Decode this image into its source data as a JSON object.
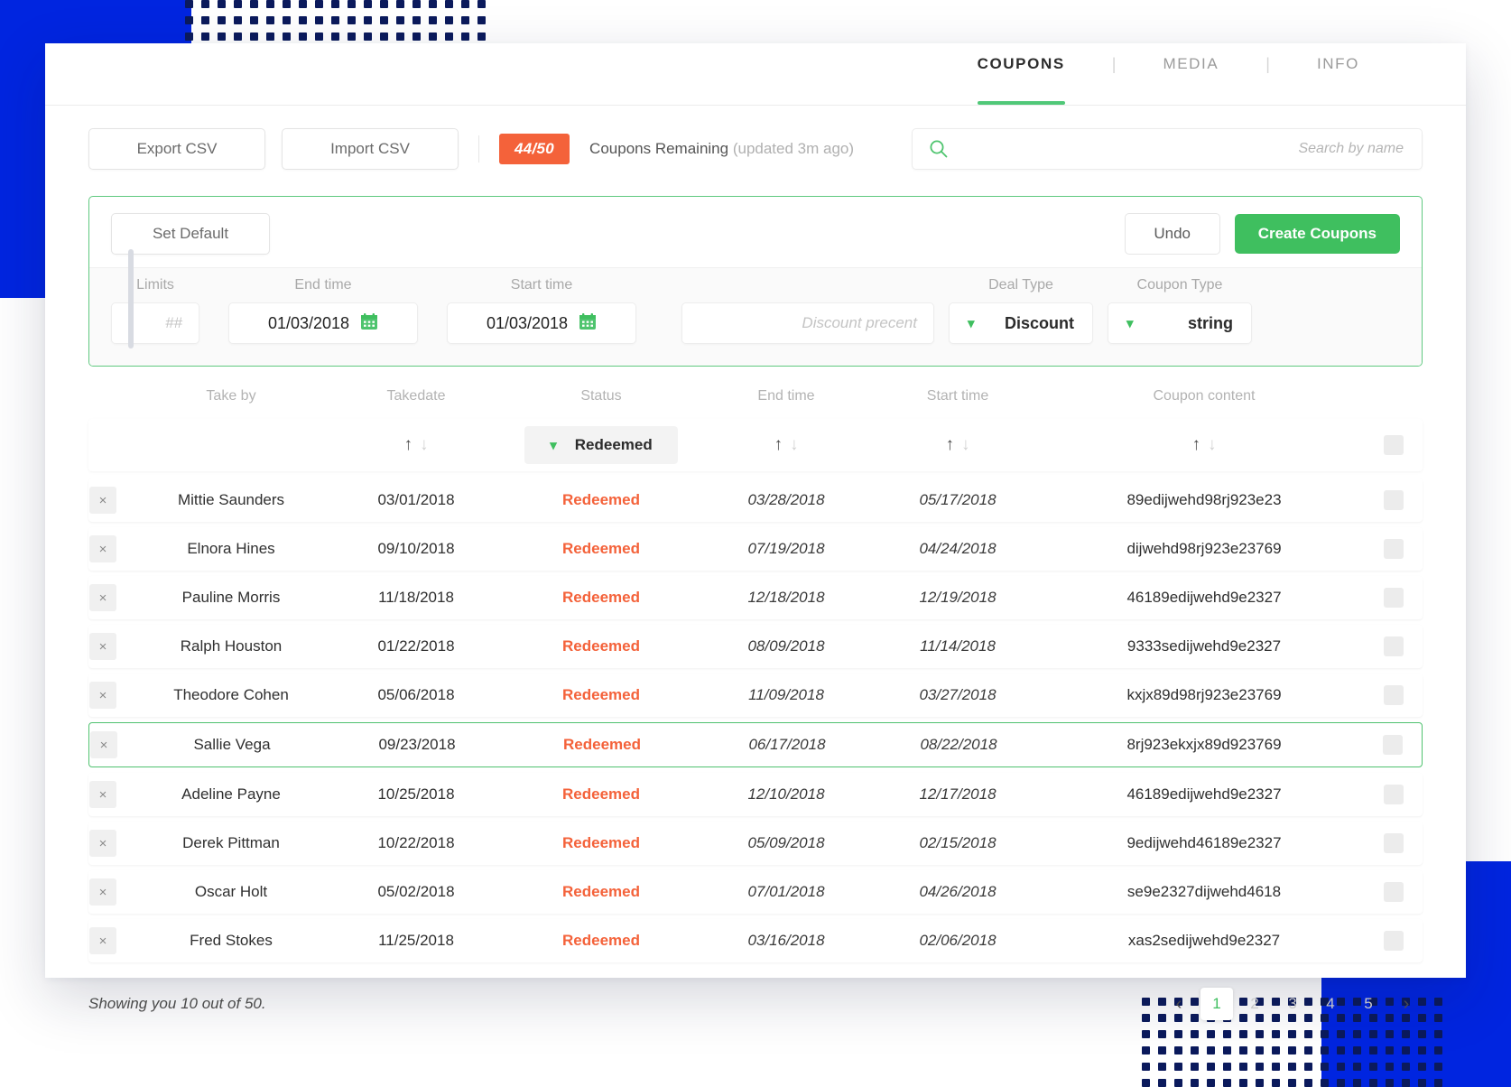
{
  "tabs": [
    {
      "label": "COUPONS",
      "active": true
    },
    {
      "label": "MEDIA",
      "active": false
    },
    {
      "label": "INFO",
      "active": false
    }
  ],
  "tab_separator": "|",
  "toolbar": {
    "export_label": "Export CSV",
    "import_label": "Import CSV",
    "badge": "44/50",
    "remaining_label": "Coupons Remaining",
    "remaining_note": "(updated 3m ago)"
  },
  "search": {
    "placeholder": "Search by name",
    "value": "",
    "icon": "search-icon"
  },
  "panel": {
    "set_default_label": "Set Default",
    "undo_label": "Undo",
    "create_label": "Create Coupons",
    "fields": {
      "limits_label": "Limits",
      "limits_placeholder": "##",
      "limits_value": "",
      "end_time_label": "End time",
      "end_time_value": "01/03/2018",
      "start_time_label": "Start time",
      "start_time_value": "01/03/2018",
      "discount_placeholder": "Discount precent",
      "discount_value": "",
      "deal_type_label": "Deal Type",
      "deal_type_value": "Discount",
      "coupon_type_label": "Coupon Type",
      "coupon_type_value": "string"
    }
  },
  "table": {
    "headers": {
      "take_by": "Take by",
      "takedate": "Takedate",
      "status": "Status",
      "end_time": "End time",
      "start_time": "Start time",
      "coupon_content": "Coupon content"
    },
    "filter": {
      "status_value": "Redeemed",
      "sort_up": "↑",
      "sort_down": "↓"
    },
    "rows": [
      {
        "name": "Mittie Saunders",
        "takedate": "03/01/2018",
        "status": "Redeemed",
        "end": "03/28/2018",
        "start": "05/17/2018",
        "content": "89edijwehd98rj923e23",
        "selected": false
      },
      {
        "name": "Elnora Hines",
        "takedate": "09/10/2018",
        "status": "Redeemed",
        "end": "07/19/2018",
        "start": "04/24/2018",
        "content": "dijwehd98rj923e23769",
        "selected": false
      },
      {
        "name": "Pauline Morris",
        "takedate": "11/18/2018",
        "status": "Redeemed",
        "end": "12/18/2018",
        "start": "12/19/2018",
        "content": "46189edijwehd9e2327",
        "selected": false
      },
      {
        "name": "Ralph Houston",
        "takedate": "01/22/2018",
        "status": "Redeemed",
        "end": "08/09/2018",
        "start": "11/14/2018",
        "content": "9333sedijwehd9e2327",
        "selected": false
      },
      {
        "name": "Theodore Cohen",
        "takedate": "05/06/2018",
        "status": "Redeemed",
        "end": "11/09/2018",
        "start": "03/27/2018",
        "content": "kxjx89d98rj923e23769",
        "selected": false
      },
      {
        "name": "Sallie Vega",
        "takedate": "09/23/2018",
        "status": "Redeemed",
        "end": "06/17/2018",
        "start": "08/22/2018",
        "content": "8rj923ekxjx89d923769",
        "selected": true
      },
      {
        "name": "Adeline Payne",
        "takedate": "10/25/2018",
        "status": "Redeemed",
        "end": "12/10/2018",
        "start": "12/17/2018",
        "content": "46189edijwehd9e2327",
        "selected": false
      },
      {
        "name": "Derek Pittman",
        "takedate": "10/22/2018",
        "status": "Redeemed",
        "end": "05/09/2018",
        "start": "02/15/2018",
        "content": "9edijwehd46189e2327",
        "selected": false
      },
      {
        "name": "Oscar Holt",
        "takedate": "05/02/2018",
        "status": "Redeemed",
        "end": "07/01/2018",
        "start": "04/26/2018",
        "content": "se9e2327dijwehd4618",
        "selected": false
      },
      {
        "name": "Fred Stokes",
        "takedate": "11/25/2018",
        "status": "Redeemed",
        "end": "03/16/2018",
        "start": "02/06/2018",
        "content": "xas2sedijwehd9e2327",
        "selected": false
      }
    ],
    "row_close_label": "×"
  },
  "footer": {
    "showing": "Showing you 10 out of 50.",
    "prev": "‹",
    "next": "›",
    "pages": [
      "1",
      "2",
      "3",
      "4",
      "5"
    ],
    "active_page": "1"
  },
  "colors": {
    "accent_green": "#3fbf5f",
    "status_orange": "#f4623a",
    "brand_blue": "#0025e0"
  }
}
